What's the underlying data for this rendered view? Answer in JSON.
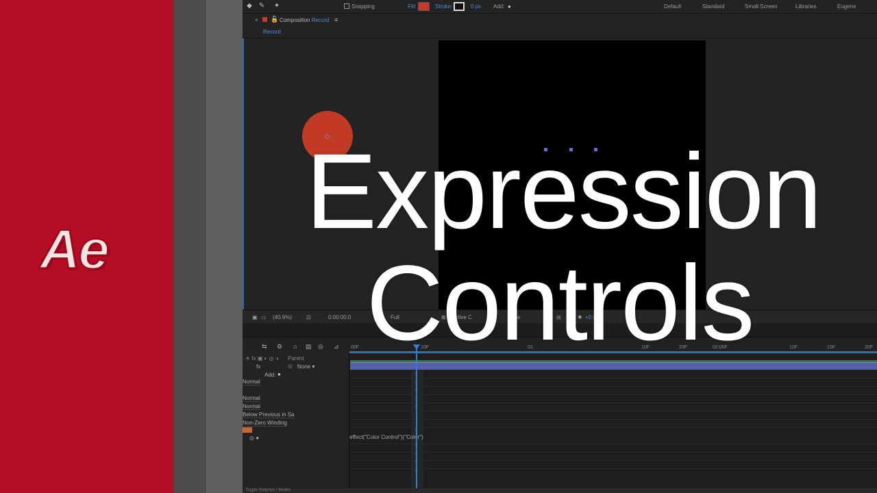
{
  "brand": {
    "logo_text": "Ae",
    "color": "#b50d23"
  },
  "title": {
    "line1": "Expression",
    "line2": "Controls"
  },
  "toolbar": {
    "snapping": "Snapping",
    "fill_label": "Fill:",
    "fill_color": "#c8392b",
    "stroke_label": "Stroke:",
    "stroke_width": "0 px",
    "add_label": "Add:",
    "workspaces": [
      "Default",
      "Standard",
      "Small Screen",
      "Libraries",
      "Eugene"
    ]
  },
  "composition": {
    "tab_prefix": "Composition",
    "tab_name": "Record",
    "breadcrumb": "Record",
    "shape_color": "#c23a26"
  },
  "viewer_footer": {
    "zoom": "(40.9%)",
    "timecode": "0:00:00:0",
    "resolution": "Full",
    "camera": "Active C",
    "view": "View",
    "exposure": "+0.0"
  },
  "timeline": {
    "ruler_labels": [
      "00F",
      "10F",
      "01",
      "10F",
      "20F",
      "02:00F",
      "10F",
      "15F",
      "20F"
    ],
    "parent_header": "Parent",
    "parent_value": "None",
    "add_label": "Add:",
    "fields": [
      "Normal",
      "Normal",
      "Normal",
      "Below Previous in Sa",
      "Non-Zero Winding"
    ],
    "expression": "effect(\"Color Control\")(\"Color\")",
    "footer_label": "Toggle Switches / Modes"
  }
}
